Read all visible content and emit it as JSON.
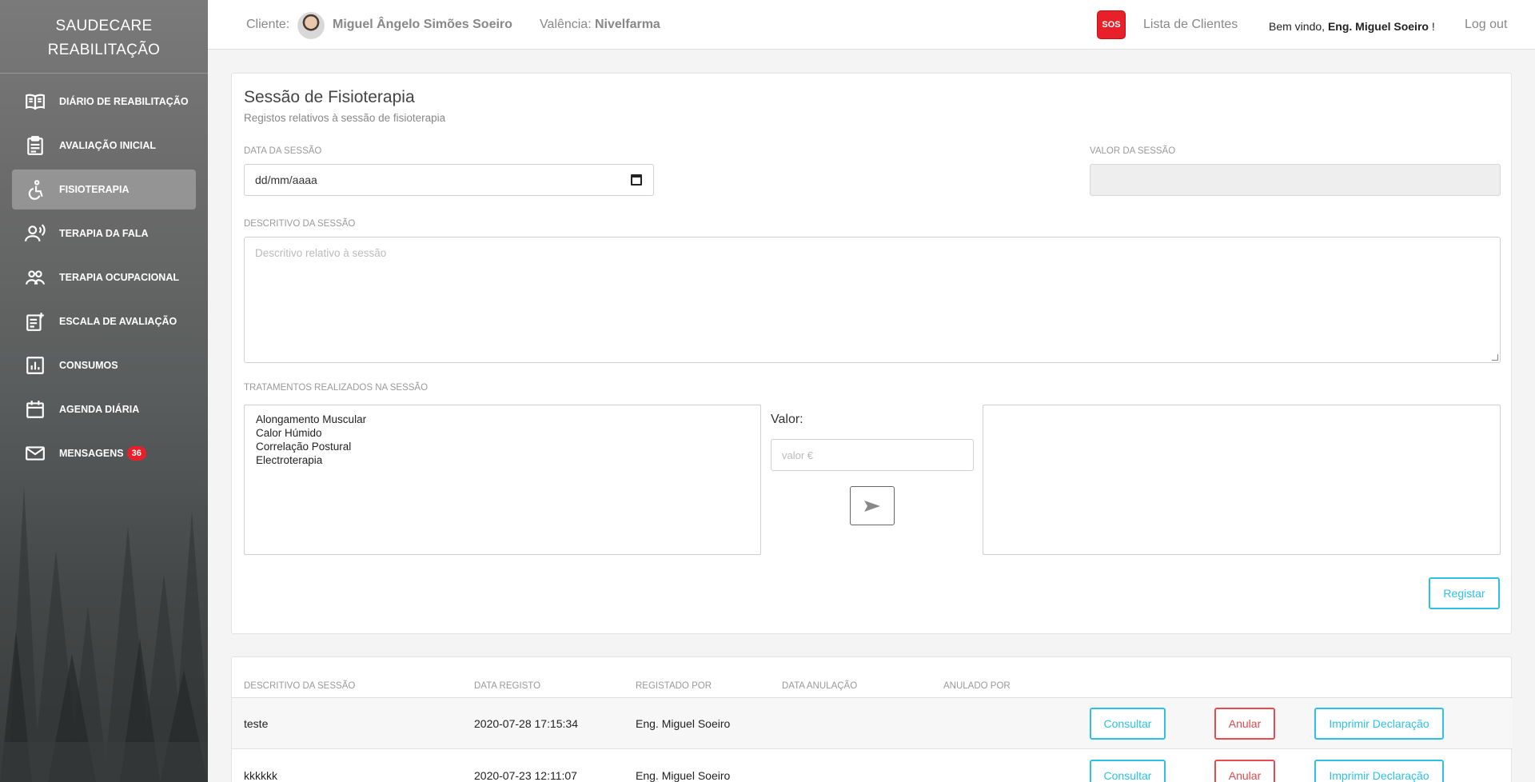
{
  "sidebar": {
    "brand_line1": "SAUDECARE",
    "brand_line2": "REABILITAÇÃO",
    "items": [
      {
        "label": "DIÁRIO DE REABILITAÇÃO",
        "icon": "book-icon"
      },
      {
        "label": "AVALIAÇÃO INICIAL",
        "icon": "clipboard-icon"
      },
      {
        "label": "FISIOTERAPIA",
        "icon": "accessible-icon",
        "active": true
      },
      {
        "label": "TERAPIA DA FALA",
        "icon": "speaker-person-icon"
      },
      {
        "label": "TERAPIA OCUPACIONAL",
        "icon": "people-icon"
      },
      {
        "label": "ESCALA DE AVALIAÇÃO",
        "icon": "note-add-icon"
      },
      {
        "label": "CONSUMOS",
        "icon": "bar-chart-icon"
      },
      {
        "label": "AGENDA DIÁRIA",
        "icon": "calendar-icon"
      },
      {
        "label": "MENSAGENS",
        "icon": "mail-icon",
        "badge": "36"
      }
    ]
  },
  "topbar": {
    "client_label": "Cliente:",
    "client_name": "Miguel Ângelo Simões Soeiro",
    "valencia_label": "Valência:",
    "valencia_name": "Nivelfarma",
    "sos": "SOS",
    "client_list": "Lista de Clientes",
    "welcome_prefix": "Bem vindo,",
    "welcome_user": "Eng. Miguel Soeiro",
    "welcome_suffix": "!",
    "logout": "Log out"
  },
  "form": {
    "title": "Sessão de Fisioterapia",
    "subtitle": "Registos relativos à sessão de fisioterapia",
    "date_label": "DATA DA SESSÃO",
    "date_placeholder": "dd/mm/aaaa",
    "value_label": "VALOR DA SESSÃO",
    "value": "",
    "description_label": "DESCRITIVO DA SESSÃO",
    "description_placeholder": "Descritivo relativo à sessão",
    "treatments_label": "TRATAMENTOS REALIZADOS NA SESSÃO",
    "treatments": [
      "Alongamento Muscular",
      "Calor Húmido",
      "Correlação Postural",
      "Electroterapia"
    ],
    "valor_label": "Valor:",
    "valor_placeholder": "valor €",
    "register_button": "Registar"
  },
  "table": {
    "headers": [
      "DESCRITIVO DA SESSÃO",
      "DATA REGISTO",
      "REGISTADO POR",
      "DATA ANULAÇÃO",
      "ANULADO POR"
    ],
    "rows": [
      {
        "descritivo": "teste",
        "data_registo": "2020-07-28 17:15:34",
        "registado_por": "Eng. Miguel Soeiro",
        "data_anulacao": "",
        "anulado_por": ""
      },
      {
        "descritivo": "kkkkkk",
        "data_registo": "2020-07-23 12:11:07",
        "registado_por": "Eng. Miguel Soeiro",
        "data_anulacao": "",
        "anulado_por": ""
      }
    ],
    "actions": {
      "consultar": "Consultar",
      "anular": "Anular",
      "imprimir": "Imprimir Declaração"
    }
  },
  "colors": {
    "accent": "#2dc1e6",
    "danger": "#e84a4f",
    "sos": "#e8202a"
  }
}
